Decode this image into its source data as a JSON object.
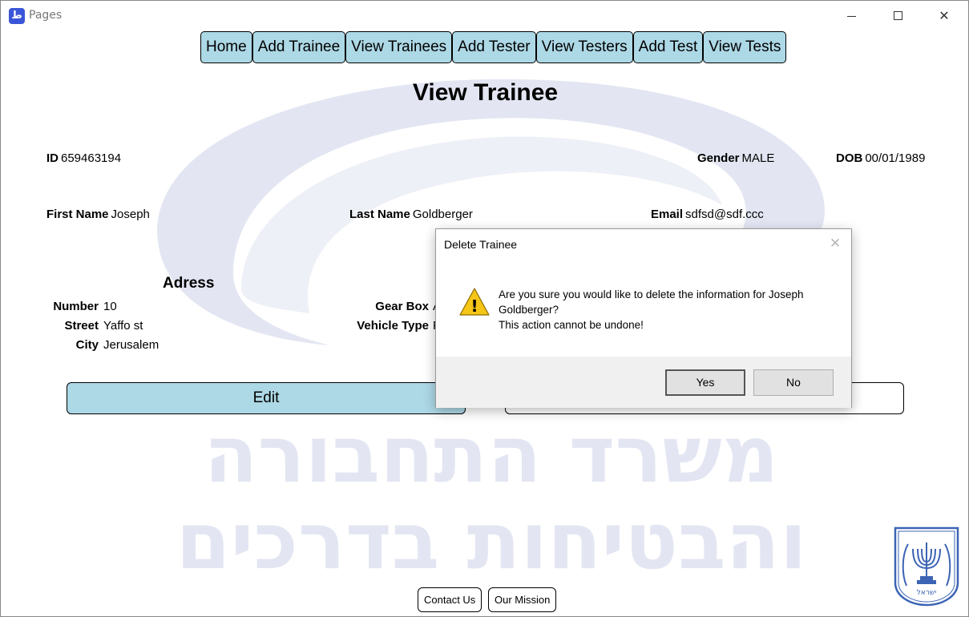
{
  "window": {
    "app_icon_glyph": "ط",
    "title": "Pages",
    "minimize_icon": "minimize-icon",
    "maximize_icon": "maximize-icon",
    "close_glyph": "✕"
  },
  "nav": {
    "items": [
      "Home",
      "Add Trainee",
      "View Trainees",
      "Add Tester",
      "View Testers",
      "Add Test",
      "View Tests"
    ]
  },
  "page": {
    "title": "View Trainee"
  },
  "trainee": {
    "id_label": "ID",
    "id_value": "659463194",
    "gender_label": "Gender",
    "gender_value": "MALE",
    "dob_label": "DOB",
    "dob_value": "00/01/1989",
    "first_name_label": "First Name",
    "first_name_value": "Joseph",
    "last_name_label": "Last Name",
    "last_name_value": "Goldberger",
    "email_label": "Email",
    "email_value": "sdfsd@sdf.ccc"
  },
  "address": {
    "heading": "Adress",
    "number_label": "Number",
    "number_value": "10",
    "street_label": "Street",
    "street_value": "Yaffo st",
    "city_label": "City",
    "city_value": "Jerusalem"
  },
  "vehicle": {
    "gearbox_label": "Gear Box",
    "gearbox_value_partial": "A",
    "type_label": "Vehicle Type",
    "type_value_partial": "P"
  },
  "actions": {
    "edit_label": "Edit"
  },
  "footer": {
    "contact_label": "Contact Us",
    "mission_label": "Our Mission"
  },
  "watermark": {
    "line1": "משרד התחבורה",
    "line2": "והבטיחות בדרכים",
    "emblem_text": "ישראל"
  },
  "dialog": {
    "title": "Delete Trainee",
    "close_glyph": "✕",
    "warning_glyph": "!",
    "message_line1": "Are you sure you would like to delete the information for Joseph",
    "message_line2": "Goldberger?",
    "message_line3": "This action cannot be undone!",
    "yes_label": "Yes",
    "no_label": "No"
  },
  "colors": {
    "nav_button": "#add8e6",
    "edit_button": "#add8e6",
    "watermark": "#e3e6f2",
    "dialog_footer": "#f0f0f0",
    "warning": "#f5c518"
  }
}
